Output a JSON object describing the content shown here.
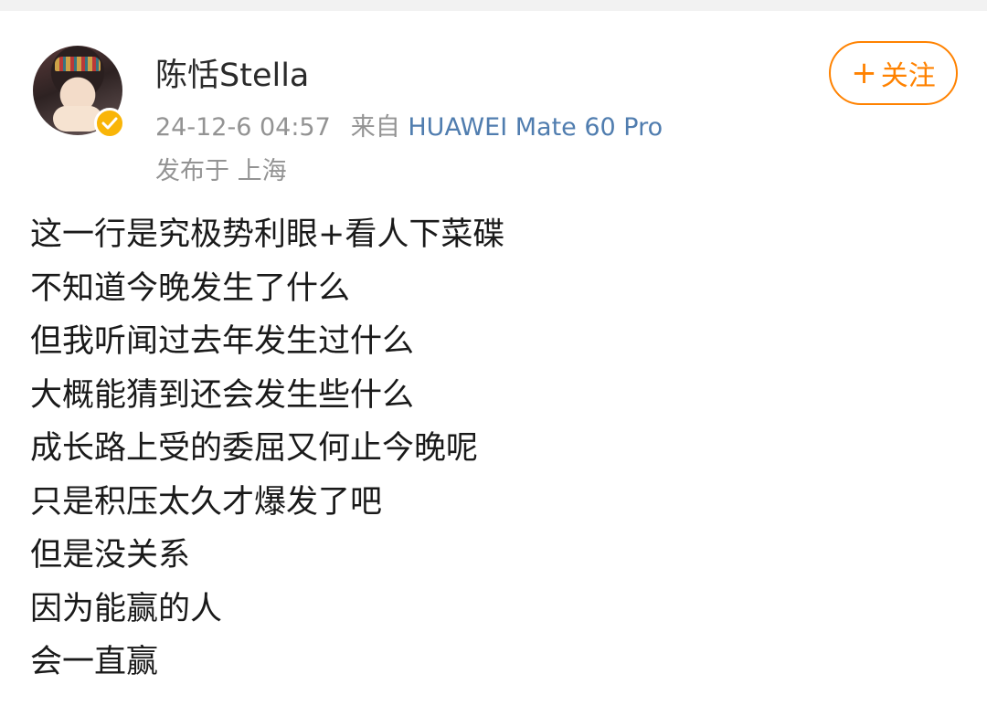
{
  "post": {
    "username": "陈恬Stella",
    "timestamp": "24-12-6 04:57",
    "source_prefix": "来自",
    "device": "HUAWEI Mate 60 Pro",
    "location": "发布于 上海",
    "follow_label": "关注",
    "verified": true,
    "lines": [
      "这一行是究极势利眼+看人下菜碟",
      "不知道今晚发生了什么",
      "但我听闻过去年发生过什么",
      "大概能猜到还会发生些什么",
      "成长路上受的委屈又何止今晚呢",
      "只是积压太久才爆发了吧",
      "但是没关系",
      "因为能赢的人",
      "会一直赢"
    ]
  },
  "colors": {
    "accent": "#ff8200",
    "link": "#507daf",
    "meta": "#939393",
    "badge": "#f9b508"
  },
  "icons": {
    "follow": "plus-icon",
    "verified": "verified-badge-icon"
  }
}
